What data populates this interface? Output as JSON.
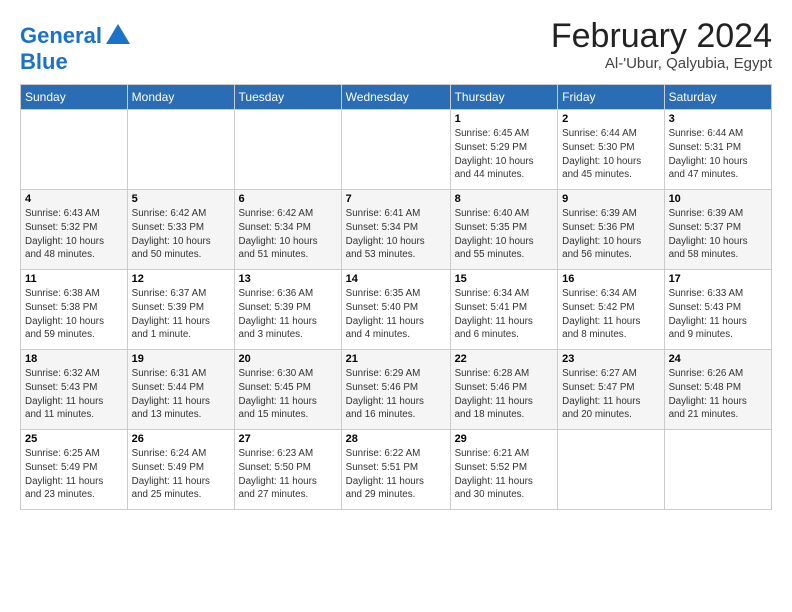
{
  "logo": {
    "line1": "General",
    "line2": "Blue"
  },
  "title": "February 2024",
  "location": "Al-'Ubur, Qalyubia, Egypt",
  "weekdays": [
    "Sunday",
    "Monday",
    "Tuesday",
    "Wednesday",
    "Thursday",
    "Friday",
    "Saturday"
  ],
  "weeks": [
    [
      {
        "day": "",
        "info": ""
      },
      {
        "day": "",
        "info": ""
      },
      {
        "day": "",
        "info": ""
      },
      {
        "day": "",
        "info": ""
      },
      {
        "day": "1",
        "info": "Sunrise: 6:45 AM\nSunset: 5:29 PM\nDaylight: 10 hours\nand 44 minutes."
      },
      {
        "day": "2",
        "info": "Sunrise: 6:44 AM\nSunset: 5:30 PM\nDaylight: 10 hours\nand 45 minutes."
      },
      {
        "day": "3",
        "info": "Sunrise: 6:44 AM\nSunset: 5:31 PM\nDaylight: 10 hours\nand 47 minutes."
      }
    ],
    [
      {
        "day": "4",
        "info": "Sunrise: 6:43 AM\nSunset: 5:32 PM\nDaylight: 10 hours\nand 48 minutes."
      },
      {
        "day": "5",
        "info": "Sunrise: 6:42 AM\nSunset: 5:33 PM\nDaylight: 10 hours\nand 50 minutes."
      },
      {
        "day": "6",
        "info": "Sunrise: 6:42 AM\nSunset: 5:34 PM\nDaylight: 10 hours\nand 51 minutes."
      },
      {
        "day": "7",
        "info": "Sunrise: 6:41 AM\nSunset: 5:34 PM\nDaylight: 10 hours\nand 53 minutes."
      },
      {
        "day": "8",
        "info": "Sunrise: 6:40 AM\nSunset: 5:35 PM\nDaylight: 10 hours\nand 55 minutes."
      },
      {
        "day": "9",
        "info": "Sunrise: 6:39 AM\nSunset: 5:36 PM\nDaylight: 10 hours\nand 56 minutes."
      },
      {
        "day": "10",
        "info": "Sunrise: 6:39 AM\nSunset: 5:37 PM\nDaylight: 10 hours\nand 58 minutes."
      }
    ],
    [
      {
        "day": "11",
        "info": "Sunrise: 6:38 AM\nSunset: 5:38 PM\nDaylight: 10 hours\nand 59 minutes."
      },
      {
        "day": "12",
        "info": "Sunrise: 6:37 AM\nSunset: 5:39 PM\nDaylight: 11 hours\nand 1 minute."
      },
      {
        "day": "13",
        "info": "Sunrise: 6:36 AM\nSunset: 5:39 PM\nDaylight: 11 hours\nand 3 minutes."
      },
      {
        "day": "14",
        "info": "Sunrise: 6:35 AM\nSunset: 5:40 PM\nDaylight: 11 hours\nand 4 minutes."
      },
      {
        "day": "15",
        "info": "Sunrise: 6:34 AM\nSunset: 5:41 PM\nDaylight: 11 hours\nand 6 minutes."
      },
      {
        "day": "16",
        "info": "Sunrise: 6:34 AM\nSunset: 5:42 PM\nDaylight: 11 hours\nand 8 minutes."
      },
      {
        "day": "17",
        "info": "Sunrise: 6:33 AM\nSunset: 5:43 PM\nDaylight: 11 hours\nand 9 minutes."
      }
    ],
    [
      {
        "day": "18",
        "info": "Sunrise: 6:32 AM\nSunset: 5:43 PM\nDaylight: 11 hours\nand 11 minutes."
      },
      {
        "day": "19",
        "info": "Sunrise: 6:31 AM\nSunset: 5:44 PM\nDaylight: 11 hours\nand 13 minutes."
      },
      {
        "day": "20",
        "info": "Sunrise: 6:30 AM\nSunset: 5:45 PM\nDaylight: 11 hours\nand 15 minutes."
      },
      {
        "day": "21",
        "info": "Sunrise: 6:29 AM\nSunset: 5:46 PM\nDaylight: 11 hours\nand 16 minutes."
      },
      {
        "day": "22",
        "info": "Sunrise: 6:28 AM\nSunset: 5:46 PM\nDaylight: 11 hours\nand 18 minutes."
      },
      {
        "day": "23",
        "info": "Sunrise: 6:27 AM\nSunset: 5:47 PM\nDaylight: 11 hours\nand 20 minutes."
      },
      {
        "day": "24",
        "info": "Sunrise: 6:26 AM\nSunset: 5:48 PM\nDaylight: 11 hours\nand 21 minutes."
      }
    ],
    [
      {
        "day": "25",
        "info": "Sunrise: 6:25 AM\nSunset: 5:49 PM\nDaylight: 11 hours\nand 23 minutes."
      },
      {
        "day": "26",
        "info": "Sunrise: 6:24 AM\nSunset: 5:49 PM\nDaylight: 11 hours\nand 25 minutes."
      },
      {
        "day": "27",
        "info": "Sunrise: 6:23 AM\nSunset: 5:50 PM\nDaylight: 11 hours\nand 27 minutes."
      },
      {
        "day": "28",
        "info": "Sunrise: 6:22 AM\nSunset: 5:51 PM\nDaylight: 11 hours\nand 29 minutes."
      },
      {
        "day": "29",
        "info": "Sunrise: 6:21 AM\nSunset: 5:52 PM\nDaylight: 11 hours\nand 30 minutes."
      },
      {
        "day": "",
        "info": ""
      },
      {
        "day": "",
        "info": ""
      }
    ]
  ]
}
